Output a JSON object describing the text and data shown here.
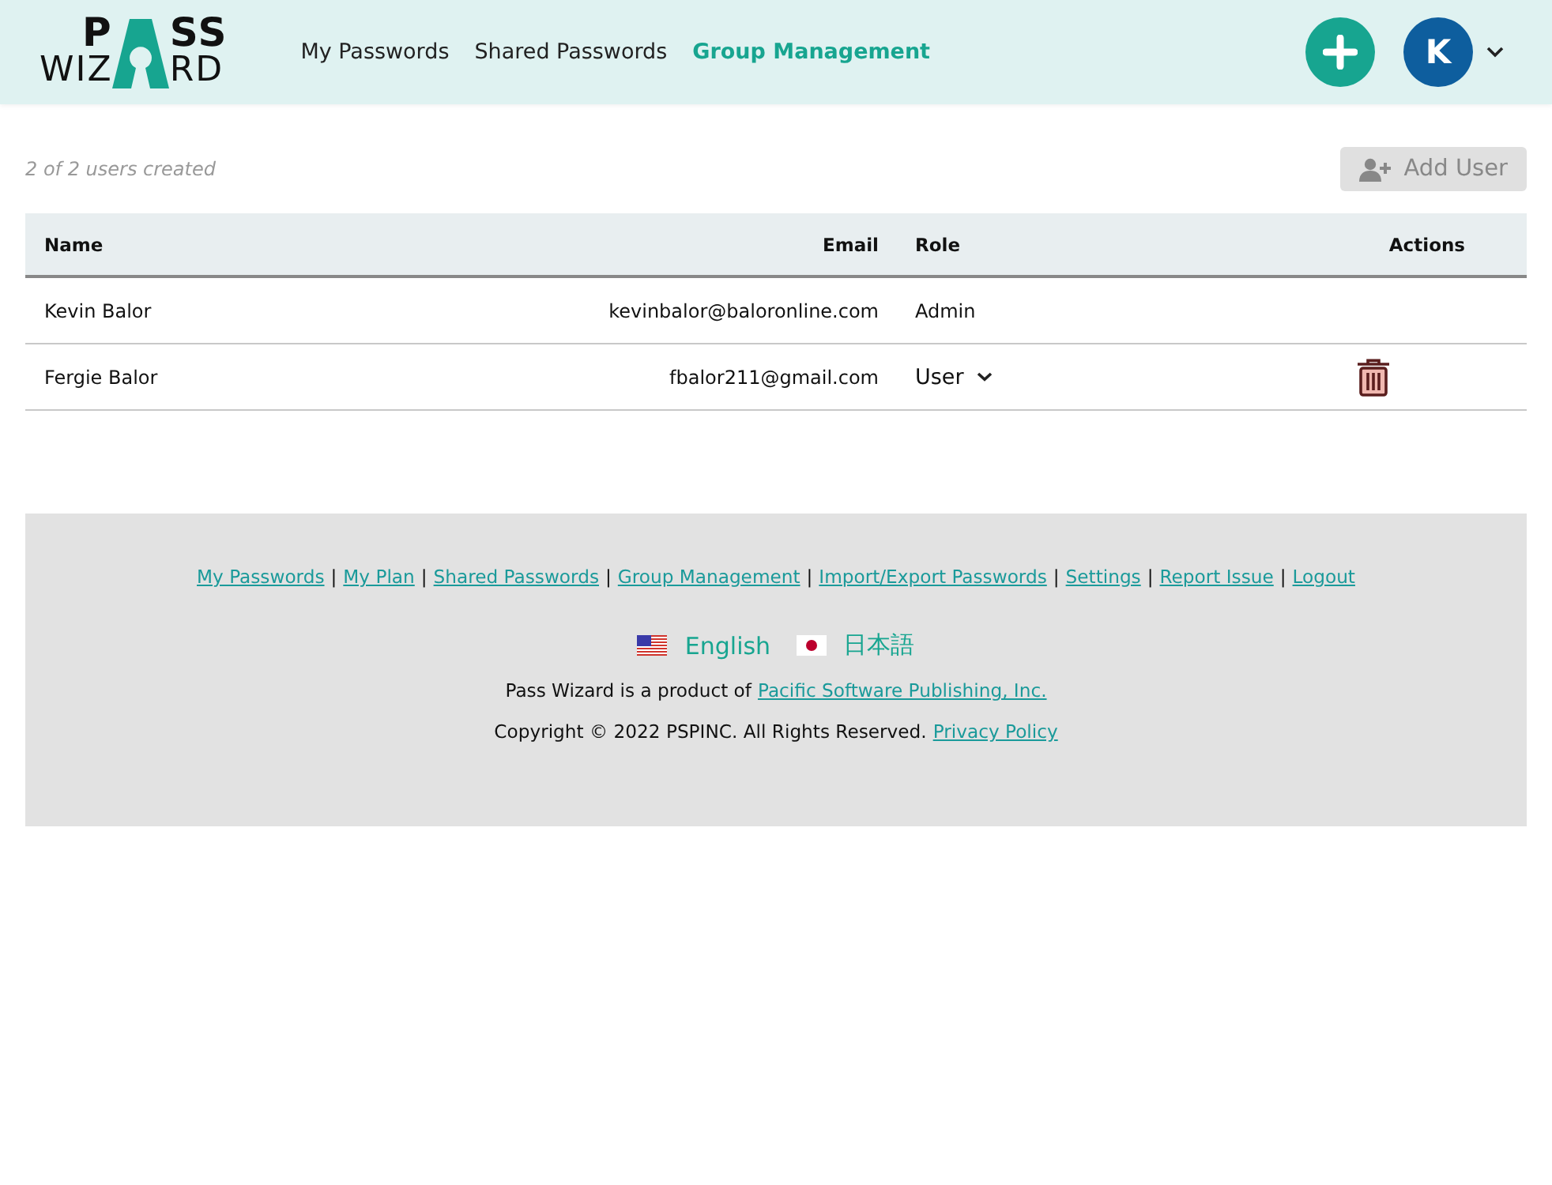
{
  "logo": {
    "top": [
      "P",
      "SS"
    ],
    "bottom": [
      "WIZ",
      "RD"
    ]
  },
  "nav": [
    {
      "label": "My Passwords",
      "selected": false
    },
    {
      "label": "Shared Passwords",
      "selected": false
    },
    {
      "label": "Group Management",
      "selected": true
    }
  ],
  "avatar": {
    "initial": "K"
  },
  "summary": "2 of 2 users created",
  "add_user_button": {
    "label": "Add User",
    "disabled": true
  },
  "table": {
    "columns": [
      "Name",
      "Email",
      "Role",
      "Actions"
    ],
    "rows": [
      {
        "name": "Kevin Balor",
        "email": "kevinbalor@baloronline.com",
        "role": {
          "kind": "text",
          "value": "Admin"
        },
        "deletable": false
      },
      {
        "name": "Fergie Balor",
        "email": "fbalor211@gmail.com",
        "role": {
          "kind": "dropdown",
          "value": "User"
        },
        "deletable": true
      }
    ]
  },
  "footer": {
    "links": [
      "My Passwords",
      "My Plan",
      "Shared Passwords",
      "Group Management",
      "Import/Export Passwords",
      "Settings",
      "Report Issue",
      "Logout"
    ],
    "separator": "|",
    "languages": [
      {
        "label": "English",
        "kind": "us"
      },
      {
        "label": "日本語",
        "kind": "jp"
      }
    ],
    "product_line": {
      "text": "Pass Wizard is a product of",
      "link": "Pacific Software Publishing, Inc."
    },
    "copyright_line": {
      "text": "Copyright © 2022 PSPINC. All Rights Reserved.",
      "link": "Privacy Policy"
    }
  }
}
